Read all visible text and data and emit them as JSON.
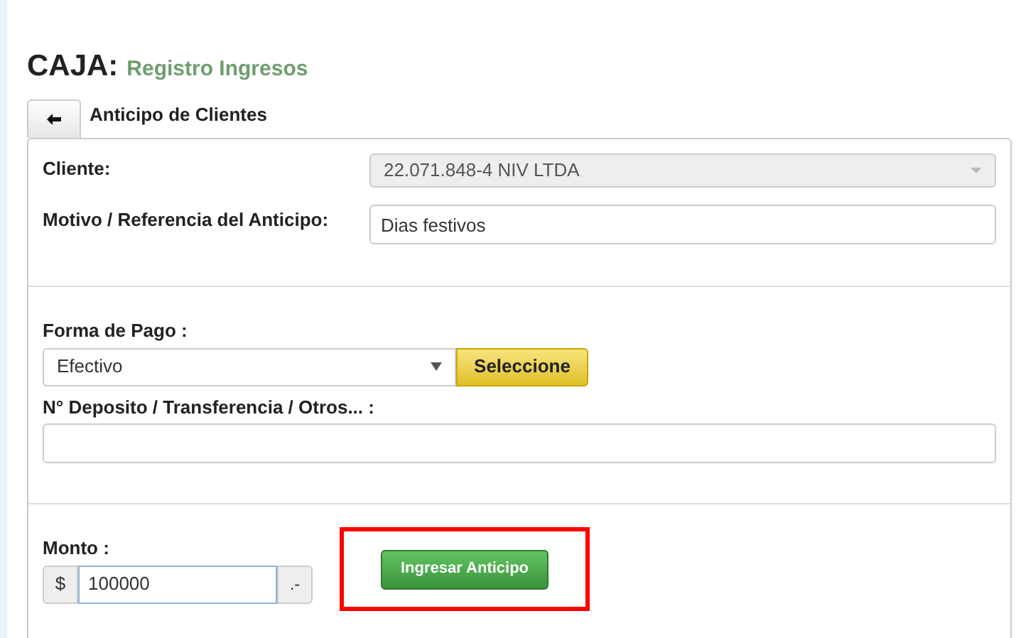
{
  "header": {
    "title": "CAJA:",
    "subtitle": "Registro Ingresos"
  },
  "section": {
    "title": "Anticipo de Clientes"
  },
  "cliente": {
    "label": "Cliente:",
    "value": "22.071.848-4 NIV LTDA",
    "disabled": true
  },
  "motivo": {
    "label": "Motivo / Referencia del Anticipo:",
    "value": "Dias festivos"
  },
  "forma_pago": {
    "label": "Forma de Pago :",
    "value": "Efectivo",
    "button": "Seleccione"
  },
  "deposito": {
    "label": "N° Deposito / Transferencia / Otros... :"
  },
  "monto": {
    "label": "Monto :",
    "prefix": "$",
    "value": "100000",
    "suffix": ".-"
  },
  "submit": {
    "label": "Ingresar Anticipo",
    "highlighted": true
  }
}
